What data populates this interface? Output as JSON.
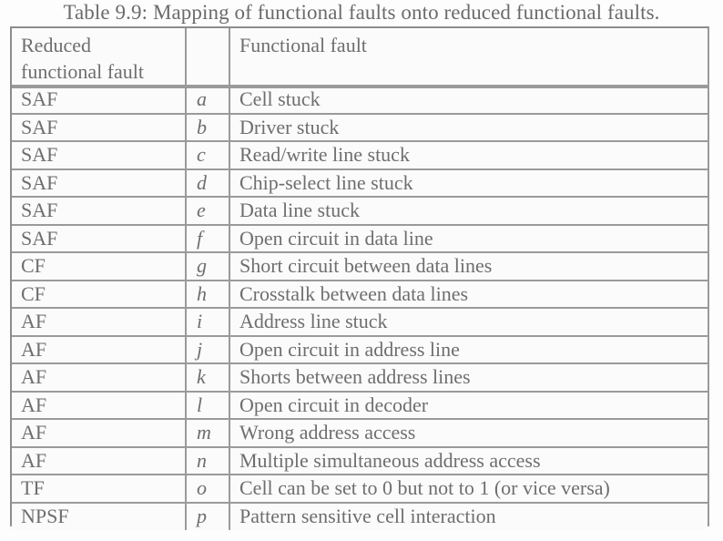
{
  "document": {
    "caption": "Table 9.9: Mapping of functional faults onto reduced functional faults."
  },
  "table": {
    "headers": {
      "reduced_line1": "Reduced",
      "reduced_line2": "functional fault",
      "letter": "",
      "fault": "Functional fault"
    },
    "rows": [
      {
        "reduced": "SAF",
        "letter": "a",
        "fault": "Cell stuck"
      },
      {
        "reduced": "SAF",
        "letter": "b",
        "fault": "Driver stuck"
      },
      {
        "reduced": "SAF",
        "letter": "c",
        "fault": "Read/write line stuck"
      },
      {
        "reduced": "SAF",
        "letter": "d",
        "fault": "Chip-select line stuck"
      },
      {
        "reduced": "SAF",
        "letter": "e",
        "fault": "Data line stuck"
      },
      {
        "reduced": "SAF",
        "letter": "f",
        "fault": "Open circuit in data line"
      },
      {
        "reduced": "CF",
        "letter": "g",
        "fault": "Short circuit between data lines"
      },
      {
        "reduced": "CF",
        "letter": "h",
        "fault": "Crosstalk between data lines"
      },
      {
        "reduced": "AF",
        "letter": "i",
        "fault": "Address line stuck"
      },
      {
        "reduced": "AF",
        "letter": "j",
        "fault": "Open circuit in address line"
      },
      {
        "reduced": "AF",
        "letter": "k",
        "fault": "Shorts between address lines"
      },
      {
        "reduced": "AF",
        "letter": "l",
        "fault": "Open circuit in decoder"
      },
      {
        "reduced": "AF",
        "letter": "m",
        "fault": "Wrong address access"
      },
      {
        "reduced": "AF",
        "letter": "n",
        "fault": "Multiple simultaneous address access"
      },
      {
        "reduced": "TF",
        "letter": "o",
        "fault": "Cell can be set to 0 but not to 1 (or vice versa)"
      },
      {
        "reduced": "NPSF",
        "letter": "p",
        "fault": "Pattern sensitive cell interaction"
      }
    ]
  },
  "colors": {
    "text": "#6e6e6e",
    "rule": "#9a9a9a",
    "page_background": "#fdfdfd",
    "table_background": "#fbfbfb"
  }
}
